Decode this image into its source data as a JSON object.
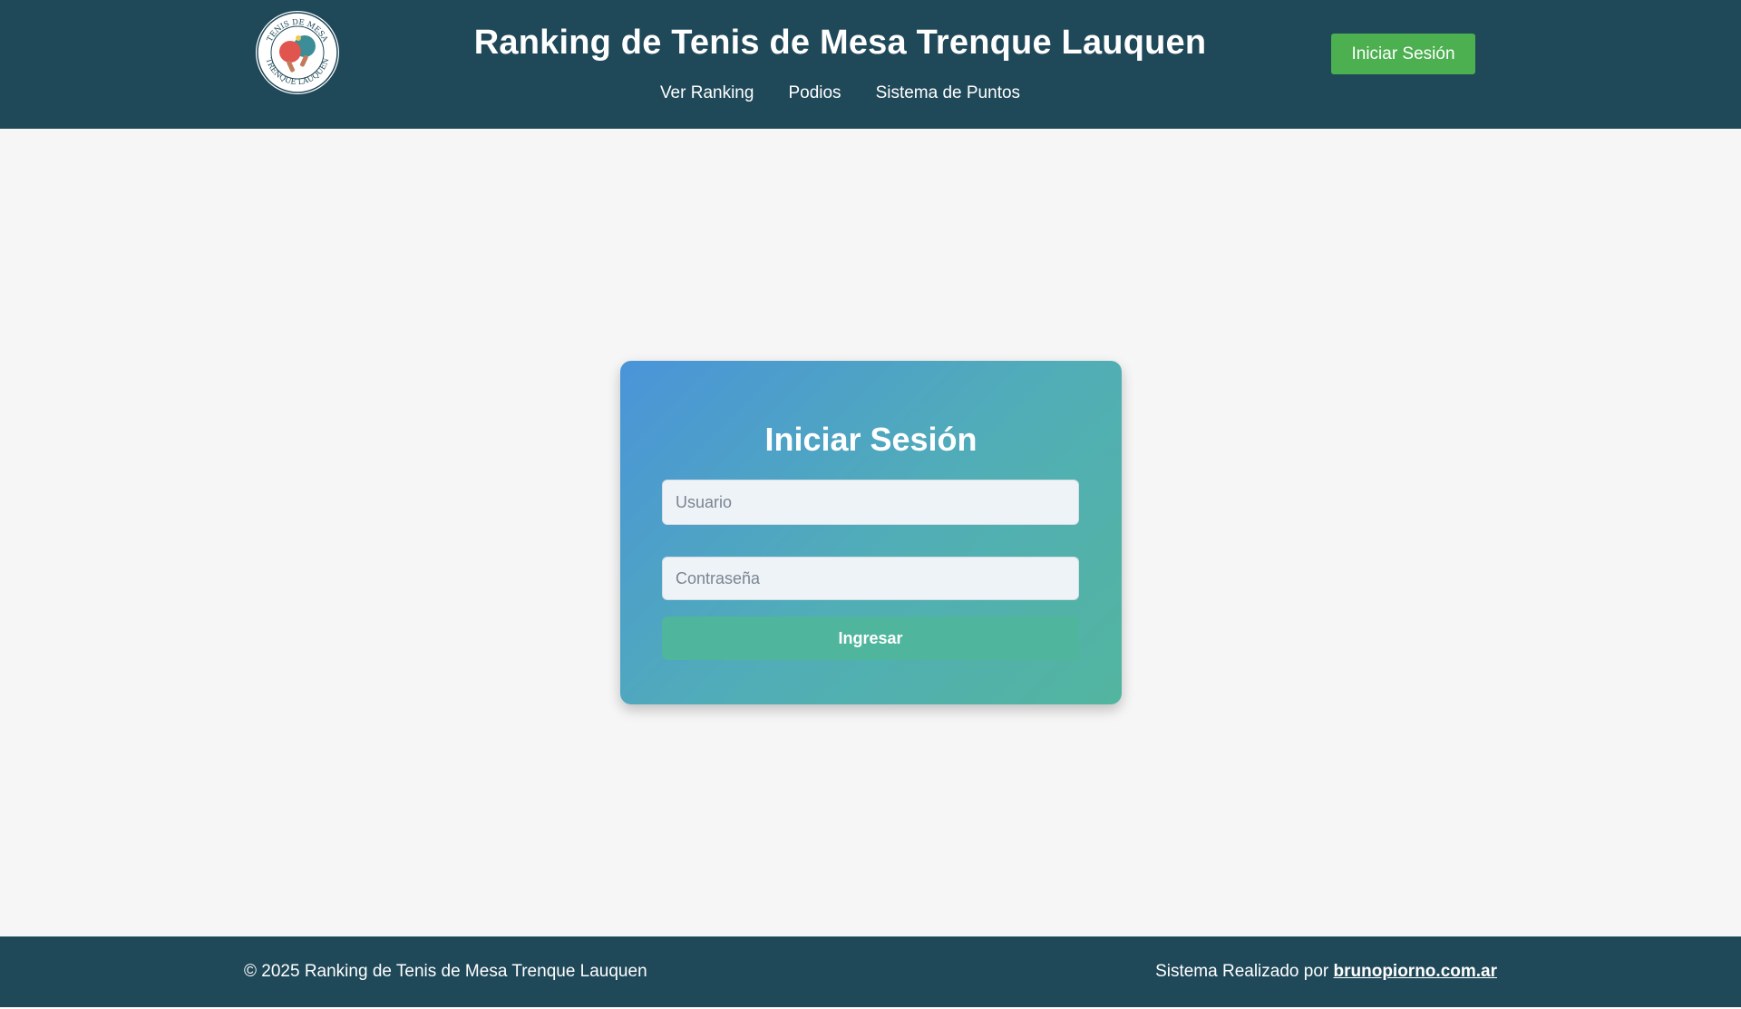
{
  "header": {
    "logo": {
      "text_top": "TENIS DE MESA",
      "text_bottom": "TRENQUE LAUQUEN",
      "icon": "ping-pong-paddles-icon"
    },
    "title": "Ranking de Tenis de Mesa Trenque Lauquen",
    "nav": [
      {
        "label": "Ver Ranking"
      },
      {
        "label": "Podios"
      },
      {
        "label": "Sistema de Puntos"
      }
    ],
    "login_button": "Iniciar Sesión"
  },
  "login": {
    "title": "Iniciar Sesión",
    "username": {
      "placeholder": "Usuario",
      "value": ""
    },
    "password": {
      "placeholder": "Contraseña",
      "value": ""
    },
    "submit_label": "Ingresar"
  },
  "footer": {
    "copyright": "© 2025 Ranking de Tenis de Mesa Trenque Lauquen",
    "credit_prefix": "Sistema Realizado por ",
    "credit_link": "brunopiorno.com.ar"
  },
  "colors": {
    "header_bg": "#1f4859",
    "accent_green": "#4caf50",
    "main_bg": "#f6f6f6",
    "card_gradient_start": "#4a94d9",
    "card_gradient_end": "#52b59f",
    "submit_bg": "#4fb59c"
  }
}
